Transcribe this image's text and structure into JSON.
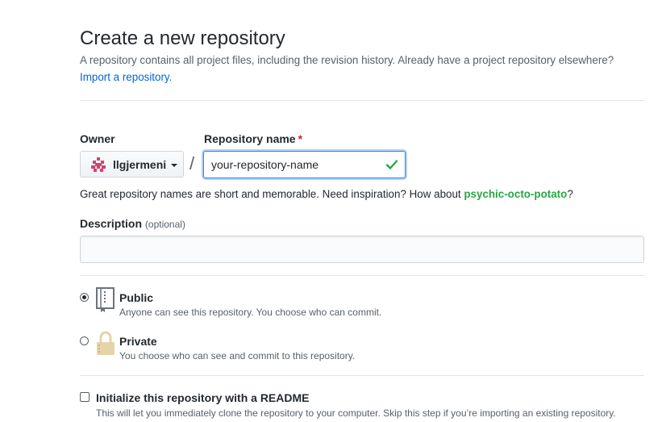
{
  "header": {
    "title": "Create a new repository",
    "subtitle": "A repository contains all project files, including the revision history. Already have a project repository elsewhere?",
    "import_link": "Import a repository."
  },
  "owner": {
    "label": "Owner",
    "value": "llgjermeni",
    "avatar_icon": "identicon",
    "avatar_color": "#d6426b"
  },
  "repository": {
    "label": "Repository name",
    "required_marker": "*",
    "separator": "/",
    "value": "your-repository-name",
    "status_icon": "check-icon",
    "status_color": "#28a745",
    "hint_prefix": "Great repository names are short and memorable. Need inspiration? How about ",
    "suggestion": "psychic-octo-potato",
    "hint_suffix": "?"
  },
  "description": {
    "label": "Description",
    "optional": "(optional)",
    "value": ""
  },
  "visibility": {
    "selected": "public",
    "options": [
      {
        "id": "public",
        "title": "Public",
        "description": "Anyone can see this repository. You choose who can commit.",
        "icon": "repo-book-icon"
      },
      {
        "id": "private",
        "title": "Private",
        "description": "You choose who can see and commit to this repository.",
        "icon": "lock-icon"
      }
    ]
  },
  "readme": {
    "checked": false,
    "label": "Initialize this repository with a README",
    "description": "This will let you immediately clone the repository to your computer. Skip this step if you’re importing an existing repository."
  },
  "colors": {
    "link": "#0366d6",
    "suggestion": "#28a745",
    "required": "#cb2431",
    "focus_border": "#2188ff"
  }
}
